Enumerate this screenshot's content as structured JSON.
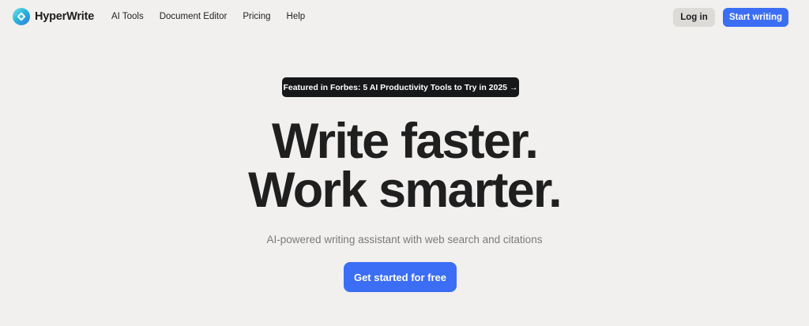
{
  "header": {
    "brand_name": "HyperWrite",
    "brand_logo_icon": "hyperwrite-logo-icon",
    "nav": [
      {
        "label": "AI Tools"
      },
      {
        "label": "Document Editor"
      },
      {
        "label": "Pricing"
      },
      {
        "label": "Help"
      }
    ],
    "login_label": "Log in",
    "start_label": "Start writing"
  },
  "hero": {
    "announcement_text": "Featured in Forbes: 5 AI Productivity Tools to Try in 2025",
    "announcement_arrow": "→",
    "headline_line1": "Write faster.",
    "headline_line2": "Work smarter.",
    "subtitle": "AI-powered writing assistant with web search and citations",
    "cta_label": "Get started for free"
  },
  "colors": {
    "background": "#f1f0ee",
    "accent": "#3b6ef5",
    "dark_pill": "#17181a",
    "secondary_button": "#dcdbd8",
    "text": "#1f1f20",
    "muted_text": "#7a7a7a"
  }
}
